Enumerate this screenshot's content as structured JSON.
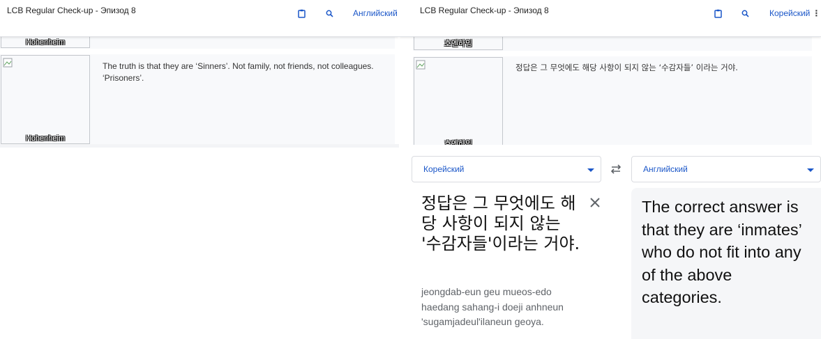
{
  "left_pane": {
    "title": "LCB Regular Check-up - Эпизод 8",
    "language": "Английский",
    "prev_caption": "Hohenheim",
    "row": {
      "caption": "Hohenheim",
      "text": "The truth is that they are ‘Sinners’. Not family, not friends, not colleagues. ‘Prisoners’."
    }
  },
  "right_pane": {
    "title": "LCB Regular Check-up - Эпизод 8",
    "language": "Корейский",
    "prev_caption": "호엔하임",
    "row": {
      "caption": "호엔하임",
      "text": "정답은 그 무엇에도 해당 사항이 되지 않는 ‘수감자들’ 이라는 거야."
    }
  },
  "translator": {
    "source_language": "Корейский",
    "target_language": "Английский",
    "source_text": "정답은 그 무엇에도 해당 사항이 되지 않는 '수감자들'이라는 거야.",
    "transliteration": "jeongdab-eun geu mueos-edo haedang sahang-i doeji anhneun 'sugamjadeul'ilaneun geoya.",
    "translation": "The correct answer is that they are ‘inmates’ who do not fit into any of the above categories."
  },
  "icons": {
    "clipboard": "clipboard-icon",
    "search": "search-icon",
    "more": "more-vertical-icon",
    "swap": "swap-icon",
    "close": "close-icon",
    "broken_image": "broken-image-icon"
  },
  "colors": {
    "accent": "#1a56c8",
    "row_bg": "#f8f9fb",
    "output_bg": "#f5f6f8"
  }
}
